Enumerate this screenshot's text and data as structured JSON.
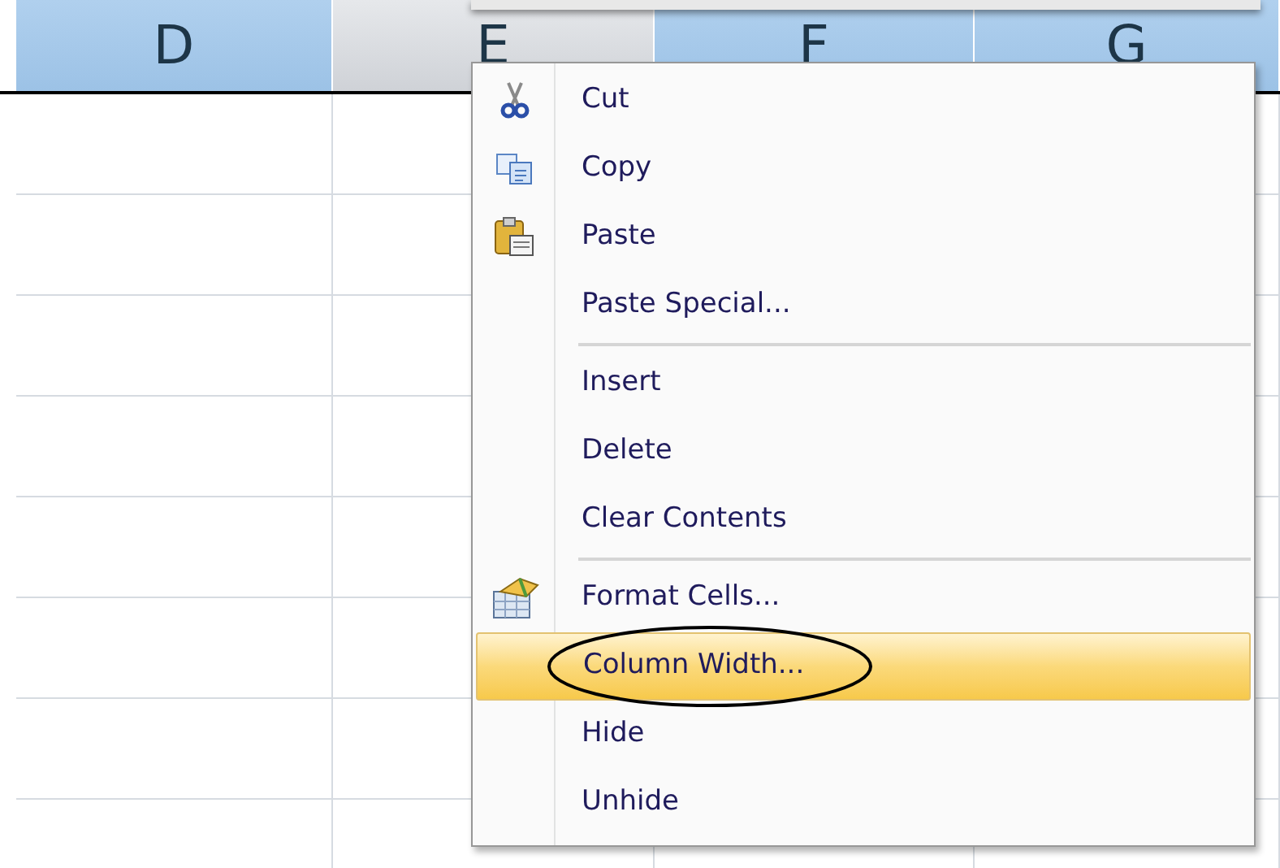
{
  "columns": [
    {
      "label": "D",
      "selected": true
    },
    {
      "label": "E",
      "selected": false
    },
    {
      "label": "F",
      "selected": true
    },
    {
      "label": "G",
      "selected": true
    }
  ],
  "context_menu": {
    "groups": [
      [
        {
          "label": "Cut",
          "kind": "cut",
          "selected": false,
          "circled": false
        },
        {
          "label": "Copy",
          "kind": "copy",
          "selected": false,
          "circled": false
        },
        {
          "label": "Paste",
          "kind": "paste",
          "selected": false,
          "circled": false
        },
        {
          "label": "Paste Special...",
          "kind": "plain",
          "selected": false,
          "circled": false
        }
      ],
      [
        {
          "label": "Insert",
          "kind": "plain",
          "selected": false,
          "circled": false
        },
        {
          "label": "Delete",
          "kind": "plain",
          "selected": false,
          "circled": false
        },
        {
          "label": "Clear Contents",
          "kind": "plain",
          "selected": false,
          "circled": false
        }
      ],
      [
        {
          "label": "Format Cells...",
          "kind": "format",
          "selected": false,
          "circled": false
        },
        {
          "label": "Column Width...",
          "kind": "plain",
          "selected": true,
          "circled": true
        },
        {
          "label": "Hide",
          "kind": "plain",
          "selected": false,
          "circled": false
        },
        {
          "label": "Unhide",
          "kind": "plain",
          "selected": false,
          "circled": false
        }
      ]
    ]
  }
}
